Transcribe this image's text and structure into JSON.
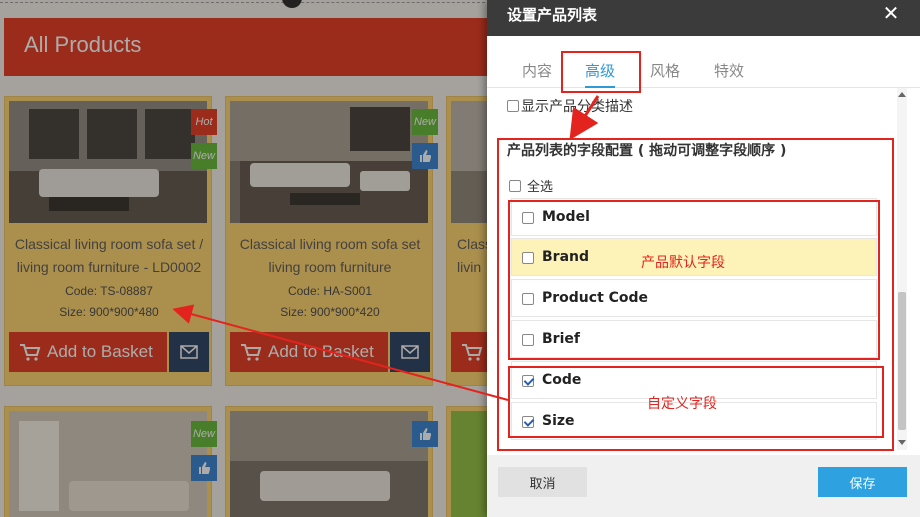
{
  "background": {
    "header_title": "All Products",
    "products": [
      {
        "title": "Classical living room sofa set / living room furniture - LD0002",
        "code": "Code: TS-08887",
        "size": "Size: 900*900*480",
        "basket_label": "Add to Basket",
        "badges": [
          "Hot",
          "New"
        ]
      },
      {
        "title": "Classical living room sofa set living room furniture",
        "code": "Code: HA-S001",
        "size": "Size: 900*900*420",
        "basket_label": "Add to Basket",
        "badges": [
          "New"
        ]
      },
      {
        "title_fragment_1": "Class",
        "title_fragment_2": "livin"
      }
    ],
    "second_row_badges": [
      "New"
    ]
  },
  "dialog": {
    "title": "设置产品列表",
    "close_icon": "close-icon",
    "tabs": [
      {
        "label": "内容",
        "active": false
      },
      {
        "label": "高级",
        "active": true
      },
      {
        "label": "风格",
        "active": false
      },
      {
        "label": "特效",
        "active": false
      }
    ],
    "show_category_desc": {
      "label": "显示产品分类描述",
      "checked": false
    },
    "field_section_title": "产品列表的字段配置 ( 拖动可调整字段顺序 )",
    "select_all": {
      "label": "全选",
      "checked": false
    },
    "fields": [
      {
        "label": "Model",
        "checked": false,
        "highlighted": false
      },
      {
        "label": "Brand",
        "checked": false,
        "highlighted": true
      },
      {
        "label": "Product Code",
        "checked": false,
        "highlighted": false
      },
      {
        "label": "Brief",
        "checked": false,
        "highlighted": false
      },
      {
        "label": "Code",
        "checked": true,
        "highlighted": false
      },
      {
        "label": "Size",
        "checked": true,
        "highlighted": false
      }
    ],
    "cancel_label": "取消",
    "save_label": "保存"
  },
  "annotations": {
    "default_fields_note": "产品默认字段",
    "custom_fields_note": "自定义字段",
    "color": "#e3241e"
  },
  "colors": {
    "accent_red": "#e3331b",
    "card_yellow": "#fcd26b",
    "tab_blue": "#2e9ad6",
    "save_blue": "#2ea1e0"
  }
}
